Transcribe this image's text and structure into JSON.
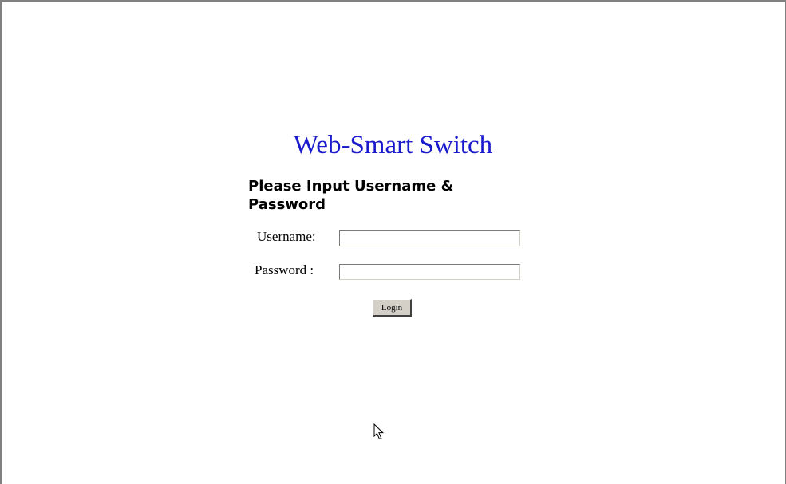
{
  "page": {
    "title": "Web-Smart Switch",
    "heading": "Please Input Username & Password"
  },
  "form": {
    "username_label": "Username:",
    "username_value": "",
    "password_label": "Password :",
    "password_value": "",
    "login_label": "Login"
  },
  "colors": {
    "title": "#1a1acd",
    "button_face": "#d4d0c8",
    "background": "#ffffff"
  },
  "icons": {
    "pointer": "mouse-pointer-icon"
  }
}
